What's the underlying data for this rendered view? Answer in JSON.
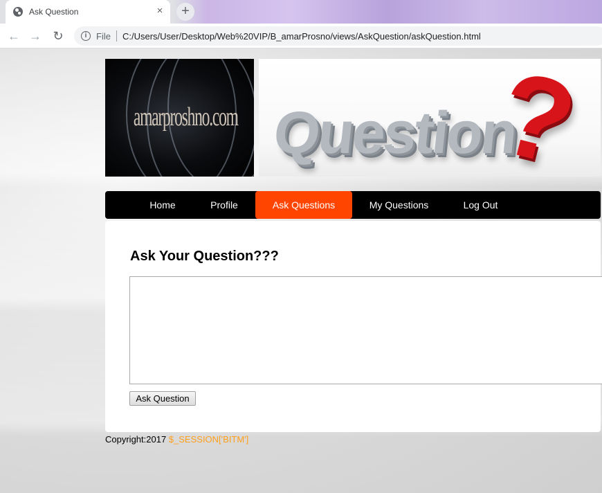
{
  "browser": {
    "tab_title": "Ask Question",
    "tab_close": "×",
    "new_tab": "+",
    "scheme_label": "File",
    "url": "C:/Users/User/Desktop/Web%20VIP/B_amarProsno/views/AskQuestion/askQuestion.html",
    "icons": [
      "globe-icon",
      "close-icon",
      "plus-icon",
      "back-arrow-icon",
      "forward-arrow-icon",
      "reload-icon",
      "info-icon"
    ]
  },
  "header": {
    "logo_text": "amarproshno.com",
    "banner_word": "Question",
    "banner_mark": "?"
  },
  "nav": {
    "items": [
      {
        "label": "Home",
        "active": false
      },
      {
        "label": "Profile",
        "active": false
      },
      {
        "label": "Ask Questions",
        "active": true
      },
      {
        "label": "My Questions",
        "active": false
      },
      {
        "label": "Log Out",
        "active": false
      }
    ],
    "active_color": "#ff4500"
  },
  "main": {
    "heading": "Ask Your Question???",
    "question_value": "",
    "submit_label": "Ask Question"
  },
  "footer": {
    "copyright": "Copyright:2017",
    "session_text": "$_SESSION['BITM']",
    "session_color": "#ff9f1a"
  }
}
